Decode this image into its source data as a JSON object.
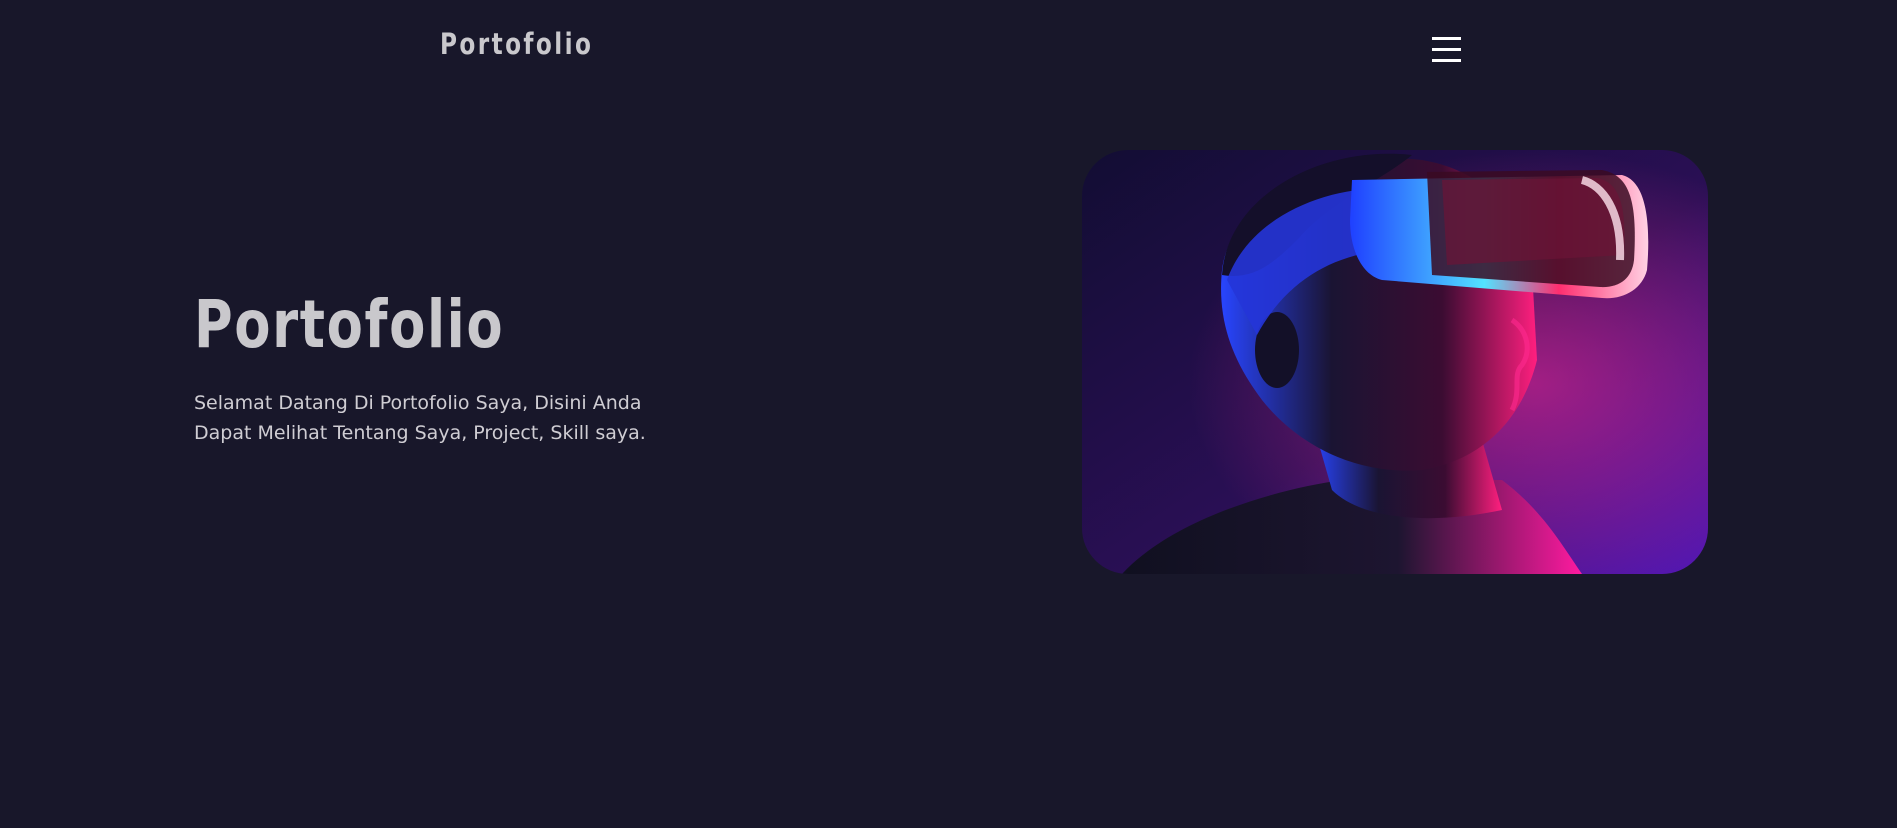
{
  "header": {
    "brand": "Portofolio",
    "menu_icon": "hamburger-menu-icon"
  },
  "hero": {
    "title": "Portofolio",
    "description": "Selamat Datang Di Portofolio Saya, Disini Anda Dapat Melihat Tentang Saya, Project, Skill saya.",
    "image_icon": "vr-headset-portrait-image"
  },
  "colors": {
    "background": "#18172a",
    "text": "#c9c8cc",
    "accent_pink": "#ff1f8f",
    "accent_blue": "#2f5bff",
    "accent_purple": "#5a12b8"
  }
}
